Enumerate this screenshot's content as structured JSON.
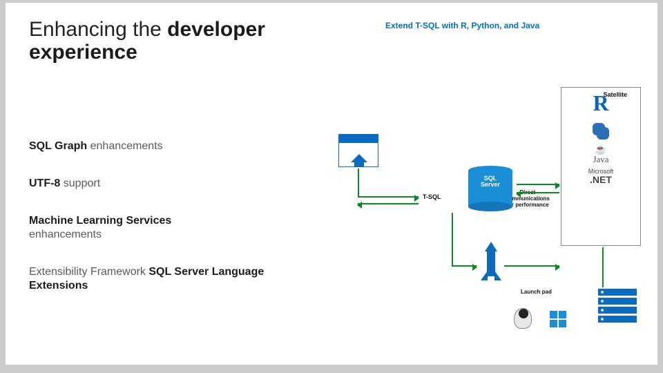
{
  "title_line1": "Enhancing the",
  "title_line2": "developer experience",
  "bullets": {
    "b0": {
      "bold": "SQL Graph",
      "rest": " enhancements"
    },
    "b1": {
      "bold": "UTF-8",
      "rest": " support"
    },
    "b2": {
      "bold": "Machine Learning Services",
      "rest": " enhancements"
    },
    "b3": {
      "pre": "Extensibility Framework ",
      "bold": "SQL Server Language Extensions"
    }
  },
  "diagram": {
    "subtitle": "Extend T-SQL with R, Python, and Java",
    "satellite_label": "Satellite",
    "sql_label_l1": "SQL",
    "sql_label_l2": "Server",
    "tsql_label": "T-SQL",
    "direct_l1": "Direct",
    "direct_l2": "communications",
    "direct_l3": "for performance",
    "launchpad_label": "Launch pad",
    "langs": {
      "r": "R",
      "java": "Java",
      "net_top": "Microsoft",
      "net_big": ".NET"
    }
  }
}
